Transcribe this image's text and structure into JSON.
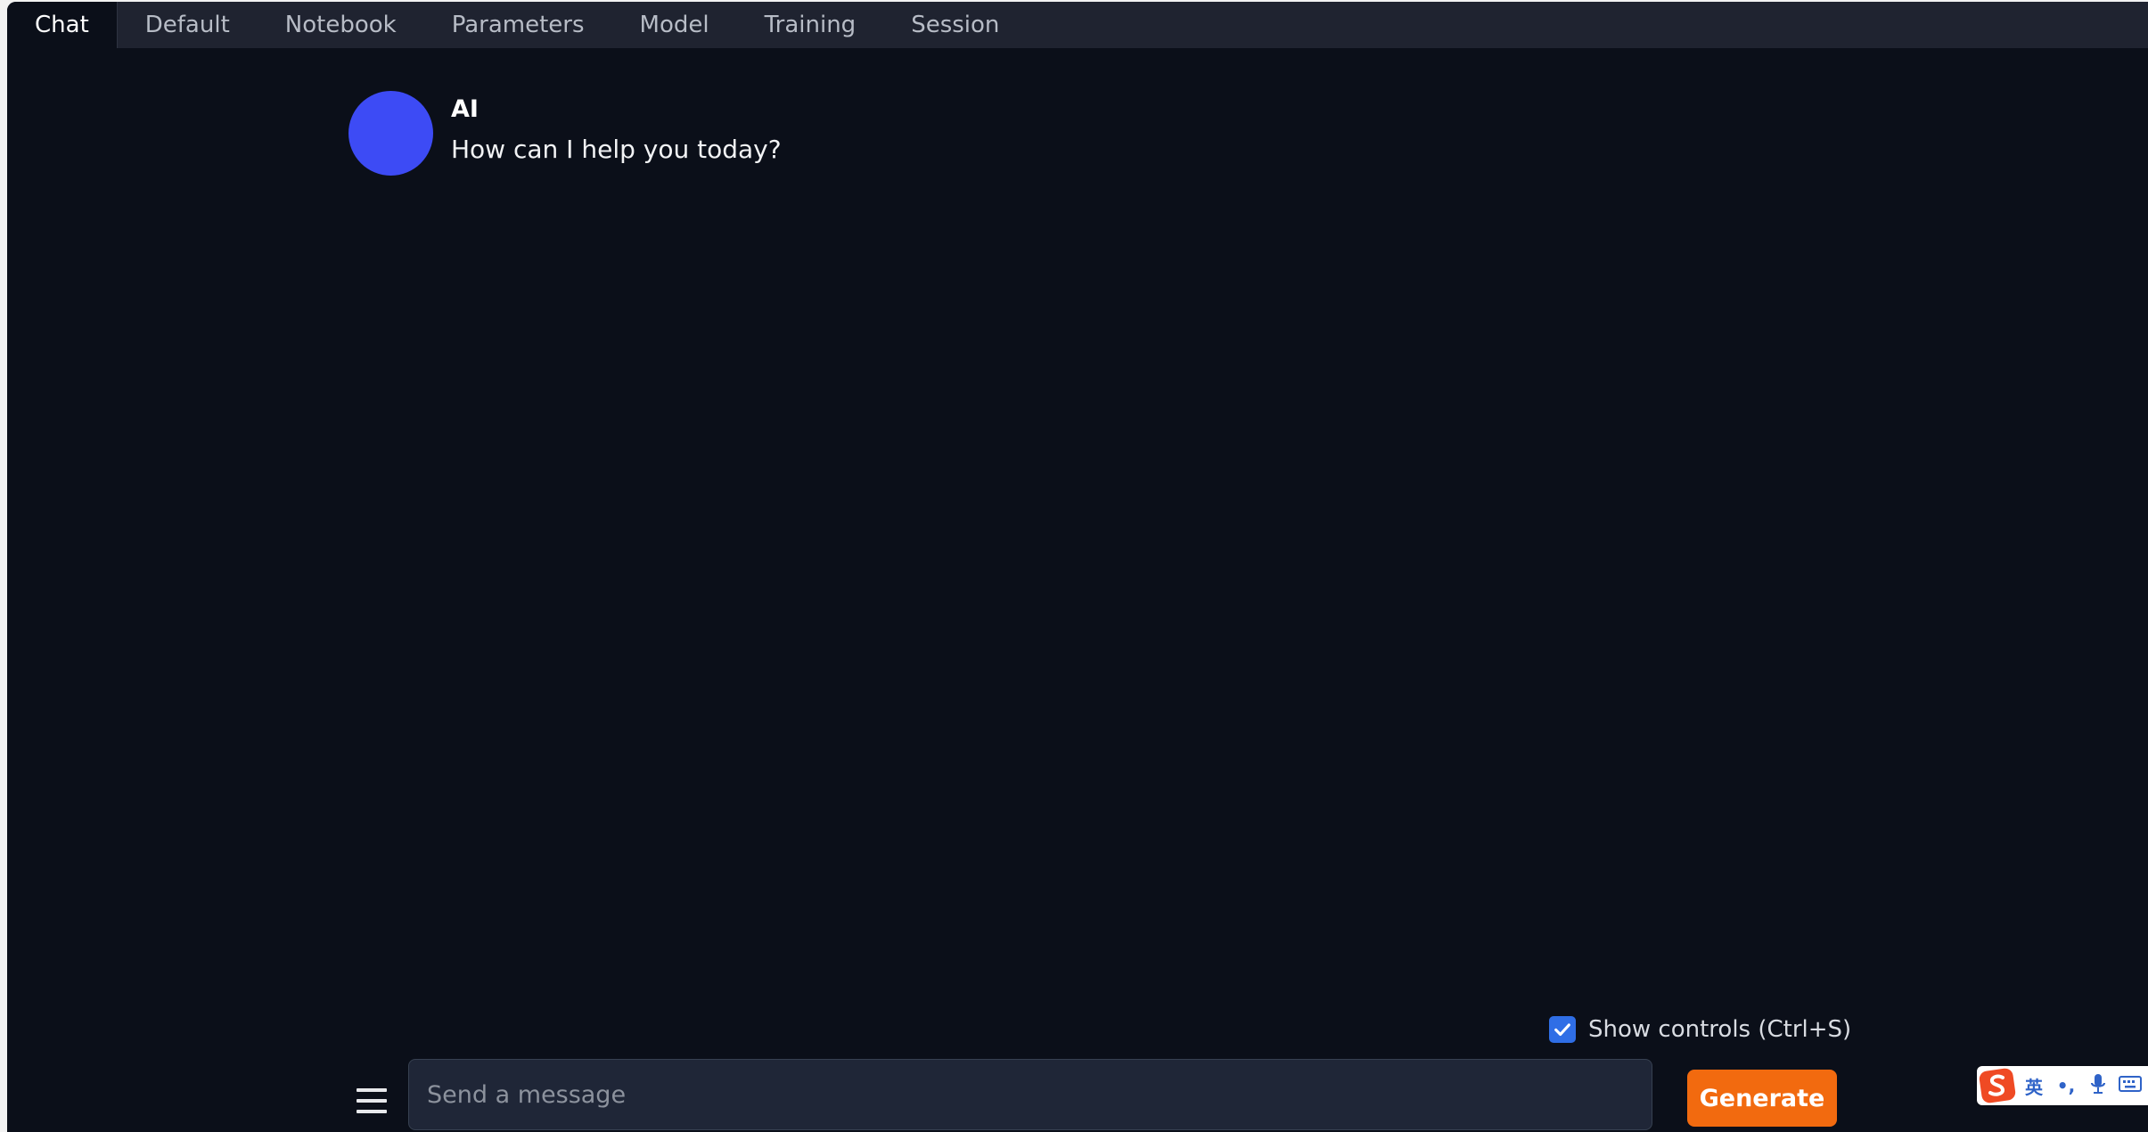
{
  "tabs": [
    {
      "label": "Chat",
      "active": true
    },
    {
      "label": "Default",
      "active": false
    },
    {
      "label": "Notebook",
      "active": false
    },
    {
      "label": "Parameters",
      "active": false
    },
    {
      "label": "Model",
      "active": false
    },
    {
      "label": "Training",
      "active": false
    },
    {
      "label": "Session",
      "active": false
    }
  ],
  "chat": {
    "message": {
      "author": "AI",
      "text": "How can I help you today?"
    }
  },
  "controls": {
    "show_controls_label": "Show controls (Ctrl+S)",
    "show_controls_checked": true
  },
  "input": {
    "placeholder": "Send a message",
    "value": ""
  },
  "generate_label": "Generate",
  "ime": {
    "language_label": "英",
    "punctuation_label": "•,"
  },
  "colors": {
    "background": "#0b0f19",
    "tabbar": "#1f2330",
    "avatar": "#3d4bf5",
    "accent": "#f26a0f",
    "checkbox": "#2f6ee6",
    "input_bg": "#1f2637"
  },
  "icons": {
    "menu": "hamburger-icon",
    "checkbox": "checkmark-icon",
    "ime_logo": "sogou-logo-icon",
    "voice": "microphone-icon",
    "keyboard": "keyboard-icon"
  }
}
